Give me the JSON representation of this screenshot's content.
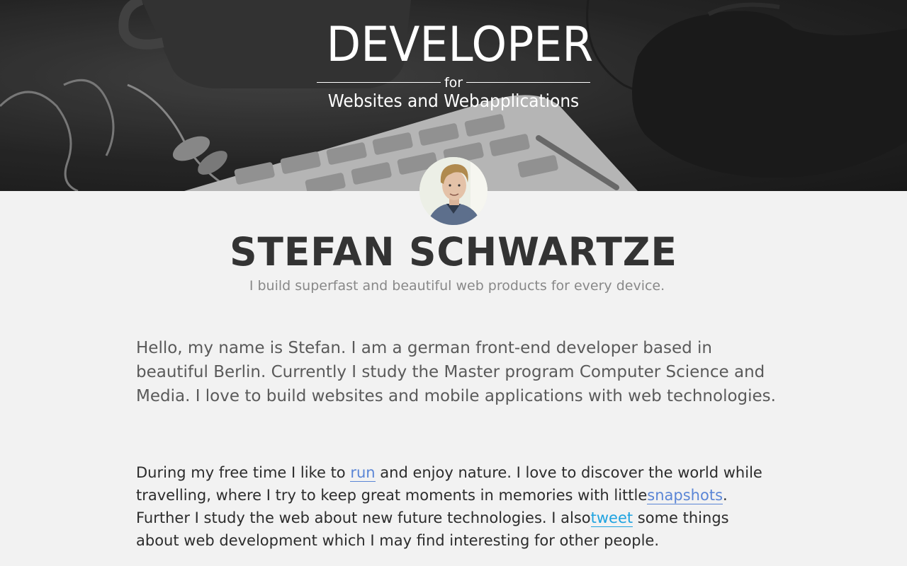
{
  "hero": {
    "title": "DEVELOPER",
    "connector": "for",
    "subtitle": "Websites and Webapplications"
  },
  "profile": {
    "name": "STEFAN SCHWARTZE",
    "tagline": "I build superfast and beautiful web products for every device."
  },
  "intro": {
    "text": "Hello, my name is Stefan. I am a german front-end developer based in beautiful Berlin. Currently I study the Master program Computer Science and Media. I love to build websites and mobile applications with web technologies."
  },
  "free_time": {
    "part1": "During my free time I like to ",
    "link_run": "run",
    "part2": " and enjoy nature. I love to discover the world while travelling, where I try to keep great moments in memories with little",
    "link_snapshots": "snapshots",
    "part3": ". Further I study the web about new future technologies. I also",
    "link_tweet": "tweet",
    "part4": " some things about web development which I may find interesting for other people."
  },
  "colors": {
    "background": "#f2f2f2",
    "link_primary": "#5b86d6",
    "link_twitter": "#1fa3e0",
    "heading": "#333333",
    "muted": "#888888"
  }
}
